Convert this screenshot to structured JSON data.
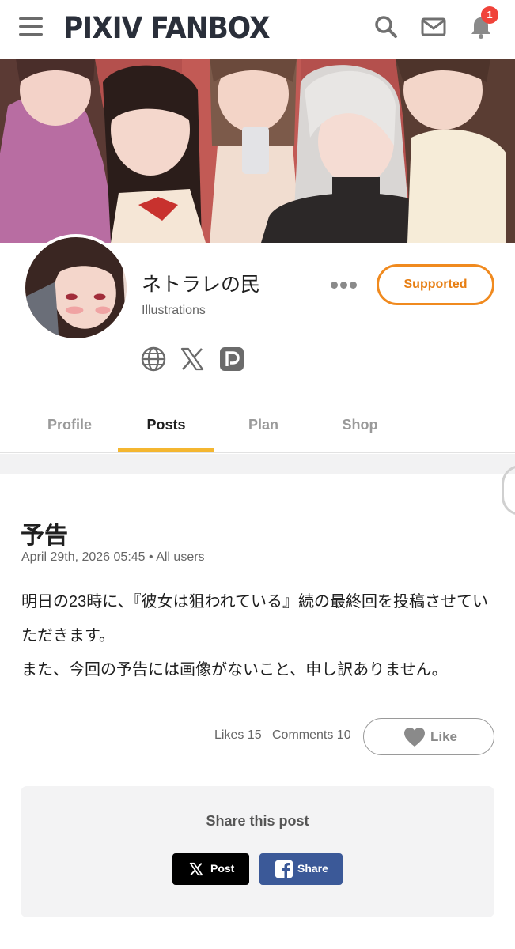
{
  "header": {
    "logo": "PIXIV FANBOX",
    "icons": [
      "menu-icon",
      "search-icon",
      "mail-icon",
      "bell-icon"
    ],
    "notification_count": "1"
  },
  "creator": {
    "name": "ネトラレの民",
    "category": "Illustrations",
    "support_button": "Supported",
    "social_icons": [
      "globe-icon",
      "x-icon",
      "pixiv-icon"
    ]
  },
  "tabs": [
    {
      "label": "Profile",
      "active": false
    },
    {
      "label": "Posts",
      "active": true
    },
    {
      "label": "Plan",
      "active": false
    },
    {
      "label": "Shop",
      "active": false
    }
  ],
  "post": {
    "title": "予告",
    "date": "April 29th, 2026 05:45",
    "audience": "All users",
    "body_line1": "明日の23時に、『彼女は狙われている』続の最終回を投稿させていただきます。",
    "body_line2": "また、今回の予告には画像がないこと、申し訳ありません。",
    "likes_label": "Likes 15",
    "comments_label": "Comments 10",
    "like_button": "Like"
  },
  "share": {
    "title": "Share this post",
    "x_button": "Post",
    "facebook_button": "Share"
  },
  "colors": {
    "accent_orange": "#f08a1f",
    "tab_underline": "#f4b630",
    "badge_red": "#f0433a",
    "facebook_blue": "#3b5998"
  }
}
